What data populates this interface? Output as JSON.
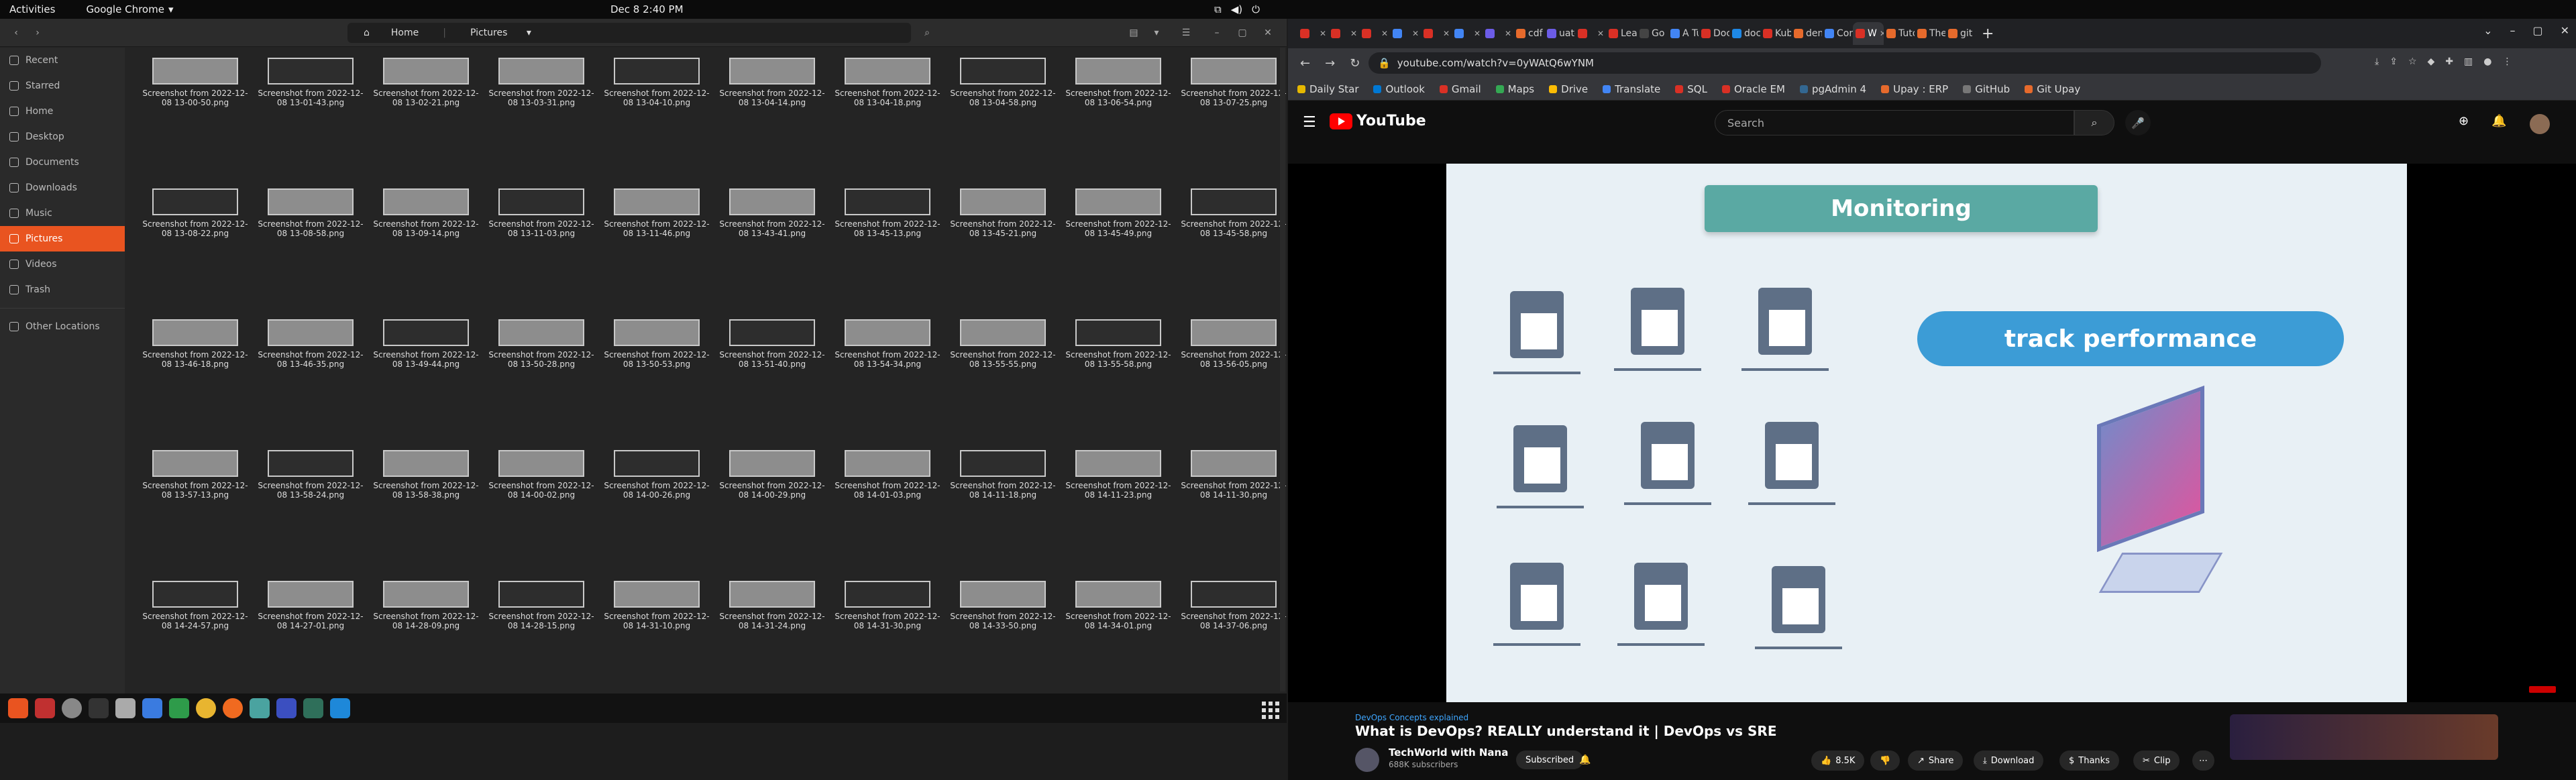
{
  "topbar": {
    "activities": "Activities",
    "app": "Google Chrome",
    "clock": "Dec 8  2:40 PM"
  },
  "files": {
    "crumbs": [
      "Home",
      "Pictures"
    ],
    "sidebar": [
      {
        "label": "Recent",
        "icon": "clock-icon"
      },
      {
        "label": "Starred",
        "icon": "star-icon"
      },
      {
        "label": "Home",
        "icon": "home-icon"
      },
      {
        "label": "Desktop",
        "icon": "desktop-icon"
      },
      {
        "label": "Documents",
        "icon": "document-icon"
      },
      {
        "label": "Downloads",
        "icon": "download-icon"
      },
      {
        "label": "Music",
        "icon": "music-icon"
      },
      {
        "label": "Pictures",
        "icon": "picture-icon",
        "active": true
      },
      {
        "label": "Videos",
        "icon": "video-icon"
      },
      {
        "label": "Trash",
        "icon": "trash-icon"
      },
      {
        "label": "Other Locations",
        "icon": "plus-icon"
      }
    ],
    "items": [
      "Screenshot from 2022-12-08 13-00-50.png",
      "Screenshot from 2022-12-08 13-01-43.png",
      "Screenshot from 2022-12-08 13-02-21.png",
      "Screenshot from 2022-12-08 13-03-31.png",
      "Screenshot from 2022-12-08 13-04-10.png",
      "Screenshot from 2022-12-08 13-04-14.png",
      "Screenshot from 2022-12-08 13-04-18.png",
      "Screenshot from 2022-12-08 13-04-58.png",
      "Screenshot from 2022-12-08 13-06-54.png",
      "Screenshot from 2022-12-08 13-07-25.png",
      "Screenshot from 2022-12-08 13-08-22.png",
      "Screenshot from 2022-12-08 13-08-58.png",
      "Screenshot from 2022-12-08 13-09-14.png",
      "Screenshot from 2022-12-08 13-11-03.png",
      "Screenshot from 2022-12-08 13-11-46.png",
      "Screenshot from 2022-12-08 13-43-41.png",
      "Screenshot from 2022-12-08 13-45-13.png",
      "Screenshot from 2022-12-08 13-45-21.png",
      "Screenshot from 2022-12-08 13-45-49.png",
      "Screenshot from 2022-12-08 13-45-58.png",
      "Screenshot from 2022-12-08 13-46-18.png",
      "Screenshot from 2022-12-08 13-46-35.png",
      "Screenshot from 2022-12-08 13-49-44.png",
      "Screenshot from 2022-12-08 13-50-28.png",
      "Screenshot from 2022-12-08 13-50-53.png",
      "Screenshot from 2022-12-08 13-51-40.png",
      "Screenshot from 2022-12-08 13-54-34.png",
      "Screenshot from 2022-12-08 13-55-55.png",
      "Screenshot from 2022-12-08 13-55-58.png",
      "Screenshot from 2022-12-08 13-56-05.png",
      "Screenshot from 2022-12-08 13-57-13.png",
      "Screenshot from 2022-12-08 13-58-24.png",
      "Screenshot from 2022-12-08 13-58-38.png",
      "Screenshot from 2022-12-08 14-00-02.png",
      "Screenshot from 2022-12-08 14-00-26.png",
      "Screenshot from 2022-12-08 14-00-29.png",
      "Screenshot from 2022-12-08 14-01-03.png",
      "Screenshot from 2022-12-08 14-11-18.png",
      "Screenshot from 2022-12-08 14-11-23.png",
      "Screenshot from 2022-12-08 14-11-30.png",
      "Screenshot from 2022-12-08 14-24-57.png",
      "Screenshot from 2022-12-08 14-27-01.png",
      "Screenshot from 2022-12-08 14-28-09.png",
      "Screenshot from 2022-12-08 14-28-15.png",
      "Screenshot from 2022-12-08 14-31-10.png",
      "Screenshot from 2022-12-08 14-31-24.png",
      "Screenshot from 2022-12-08 14-31-30.png",
      "Screenshot from 2022-12-08 14-33-50.png",
      "Screenshot from 2022-12-08 14-34-01.png",
      "Screenshot from 2022-12-08 14-37-06.png"
    ]
  },
  "chrome": {
    "tabs": [
      "",
      "",
      "",
      "",
      "",
      "",
      "",
      "cdf",
      "uat-",
      "",
      "Lear",
      "Go b",
      "A Tu",
      "Doc",
      "doc",
      "Kub",
      "dem",
      "Con",
      "W",
      "Tuto",
      "The",
      "git"
    ],
    "active_tab": 18,
    "url": "youtube.com/watch?v=0yWAtQ6wYNM",
    "bookmarks": [
      "Daily Star",
      "Outlook",
      "Gmail",
      "Maps",
      "Drive",
      "Translate",
      "SQL",
      "Oracle EM",
      "pgAdmin 4",
      "Upay : ERP",
      "GitHub",
      "Git Upay"
    ]
  },
  "youtube": {
    "logo": "YouTube",
    "search_placeholder": "Search",
    "video": {
      "title_card": "Monitoring",
      "pill": "track performance"
    },
    "tagline": "DevOps Concepts explained",
    "title": "What is DevOps? REALLY understand it | DevOps vs SRE",
    "channel": "TechWorld with Nana",
    "subs": "688K subscribers",
    "subscribe": "Subscribed",
    "likes": "8.5K",
    "share": "Share",
    "download": "Download",
    "thanks": "Thanks",
    "clip": "Clip"
  }
}
